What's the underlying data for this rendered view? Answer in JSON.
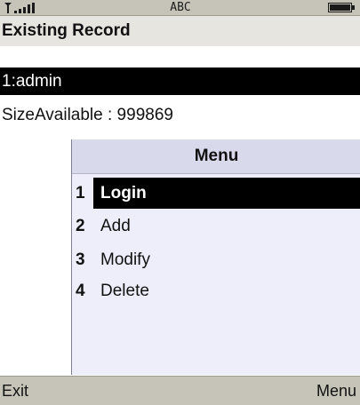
{
  "status_bar": {
    "signal_icon": "antenna-signal-icon",
    "carrier": "ABC",
    "battery_icon": "battery-icon"
  },
  "screen": {
    "title": "Existing Record",
    "records": [
      "1:admin"
    ],
    "size_available": "SizeAvailable : 999869"
  },
  "menu": {
    "title": "Menu",
    "items": [
      {
        "number": "1",
        "label": "Login",
        "selected": true
      },
      {
        "number": "2",
        "label": "Add",
        "selected": false
      },
      {
        "number": "3",
        "label": "Modify",
        "selected": false
      },
      {
        "number": "4",
        "label": "Delete",
        "selected": false
      }
    ]
  },
  "softkeys": {
    "left": "Exit",
    "right": "Menu"
  },
  "colors": {
    "status_bar": "#c6c4b8",
    "selection": "#000000",
    "menu_background": "#eeeefa",
    "menu_title": "#d8d9ea"
  }
}
